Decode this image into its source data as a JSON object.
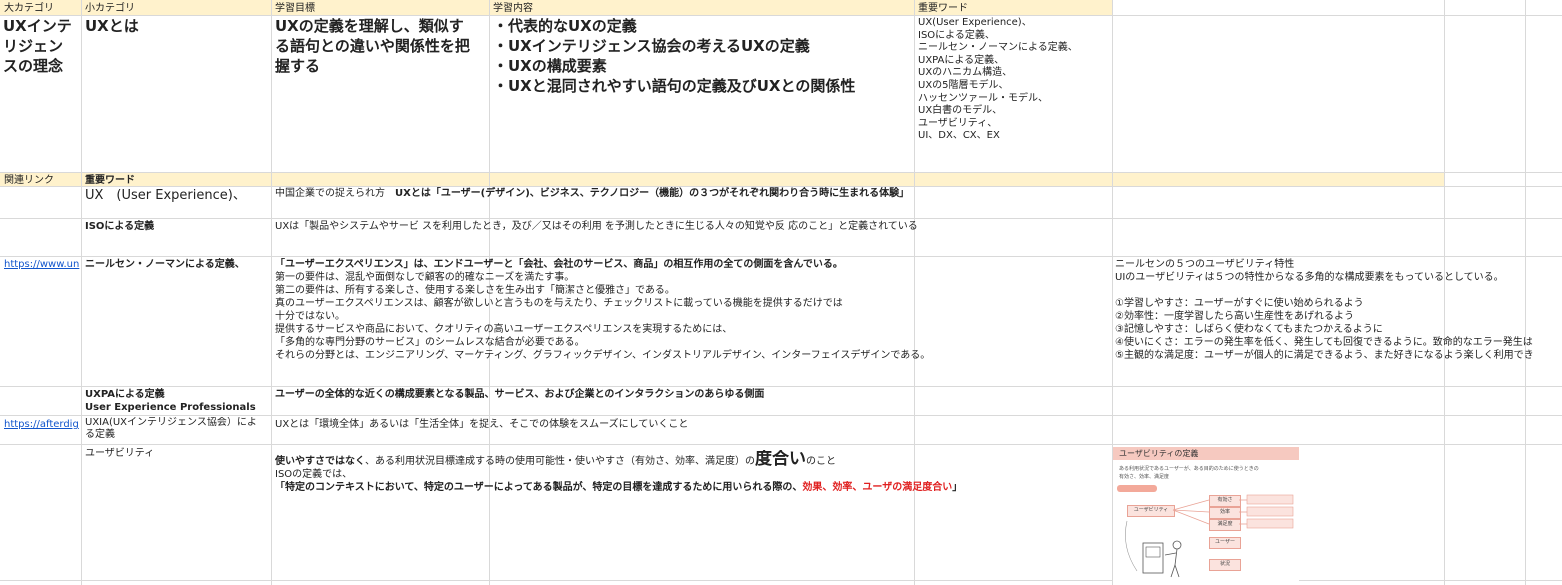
{
  "headers": {
    "main_category": "大カテゴリ",
    "sub_category": "小カテゴリ",
    "learning_goal": "学習目標",
    "learning_content": "学習内容",
    "key_words": "重要ワード"
  },
  "row1": {
    "main_category": "UXインテ\nリジェン\nスの理念",
    "sub_category": "UXとは",
    "learning_goal": "UXの定義を理解し、類似す\nる語句との違いや関係性を把\n握する",
    "learning_content": "・代表的なUXの定義\n・UXインテリジェンス協会の考えるUXの定義\n・UXの構成要素\n・UXと混同されやすい語句の定義及びUXとの関係性",
    "key_words": "UX(User Experience)、\nISOによる定義、\nニールセン・ノーマンによる定義、\nUXPAによる定義、\nUXのハニカム構造、\nUXの5階層モデル、\nハッセンツァール・モデル、\nUX白書のモデル、\nユーザビリティ、\nUI、DX、CX、EX"
  },
  "subheader": {
    "related_links": "関連リンク",
    "key_words": "重要ワード"
  },
  "rows": [
    {
      "word": "UX　(User Experience)、",
      "desc_prefix": "中国企業での捉えられ方　",
      "desc_bold": "UXとは「ユーザー(デザイン)、ビジネス、テクノロジー（機能）の３つがそれぞれ関わり合う時に生まれる体験」"
    },
    {
      "word": "ISOによる定義",
      "desc": "UXは「製品やシステムやサービ スを利用したとき，及び／又はその利用 を予測したときに生じる人々の知覚や反 応のこと」と定義されている"
    },
    {
      "link": "https://www.un",
      "word": "ニールセン・ノーマンによる定義、",
      "desc_bold": "「ユーザーエクスペリエンス」は、エンドユーザーと「会社、会社のサービス、商品」の相互作用の全ての側面を含んでいる。",
      "desc": "第一の要件は、混乱や面倒なしで顧客の的確なニーズを満たす事。\n第二の要件は、所有する楽しさ、使用する楽しさを生み出す「簡潔さと優雅さ」である。\n真のユーザーエクスペリエンスは、顧客が欲しいと言うものを与えたり、チェックリストに載っている機能を提供するだけでは\n十分ではない。\n提供するサービスや商品において、クオリティの高いユーザーエクスペリエンスを実現するためには、\n「多角的な専門分野のサービス」のシームレスな結合が必要である。\nそれらの分野とは、エンジニアリング、マーケティング、グラフィックデザイン、インダストリアルデザイン、インターフェイスデザインである。",
      "note": "ニールセンの５つのユーザビリティ特性\nUIのユーザビリティは５つの特性からなる多角的な構成要素をもっているとしている。\n\n①学習しやすさ：ユーザーがすぐに使い始められるよう\n②効率性：一度学習したら高い生産性をあげれるよう\n③記憶しやすさ：しばらく使わなくてもまたつかえるように\n④使いにくさ：エラーの発生率を低く、発生しても回復できるように。致命的なエラー発生は\n⑤主観的な満足度：ユーザーが個人的に満足できるよう、また好きになるよう楽しく利用でき"
    },
    {
      "word": "UXPAによる定義\nUser Experience Professionals",
      "desc_bold": "ユーザーの全体的な近くの構成要素となる製品、サービス、および企業とのインタラクションのあらゆる側面"
    },
    {
      "link": "https://afterdig",
      "word": "UXIA(UXインテリジェンス協会）によ\nる定義",
      "desc": "UXとは「環境全体」あるいは「生活全体」を捉え、そこでの体験をスムーズにしていくこと"
    },
    {
      "word": "ユーザビリティ",
      "line1_bold": "使いやすさではなく",
      "line1_mid": "、ある利用状況目標達成する時の使用可能性・使いやすさ（有効さ、効率、満足度）の",
      "line1_big": "度合い",
      "line1_end": "のこと",
      "line2": "ISOの定義では、",
      "line3_bold": "「特定のコンテキストにおいて、特定のユーザーによってある製品が、特定の目標を達成するために用いられる際の、",
      "line3_red": "効果、効率、ユーザの満足度合い",
      "line3_end": "」"
    }
  ],
  "card": {
    "title": "ユーザビリティの定義",
    "caption": "ある利用状況であるユーザーが、ある目的のために使うときの\n有効さ、効率、満足度",
    "center": "ユーザビリティ",
    "items": [
      "有効さ",
      "効率",
      "満足度"
    ],
    "user": "ユーザー",
    "status": "状況"
  }
}
